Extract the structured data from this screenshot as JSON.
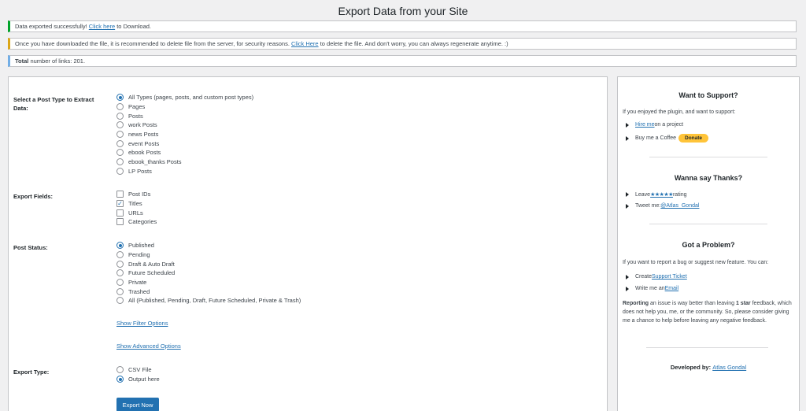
{
  "page_title": "Export Data from your Site",
  "notices": {
    "success": {
      "prefix": "Data exported successfully! ",
      "link": "Click here",
      "suffix": " to Download."
    },
    "warning": {
      "prefix": "Once you have downloaded the file, it is recommended to delete file from the server, for security reasons. ",
      "link": "Click Here",
      "suffix": " to delete the file. And don't worry, you can always regenerate anytime. :)"
    },
    "info": {
      "bold": "Total",
      "text": " number of links: 201."
    }
  },
  "form": {
    "post_type": {
      "label": "Select a Post Type to Extract Data:",
      "options": [
        "All Types (pages, posts, and custom post types)",
        "Pages",
        "Posts",
        "work Posts",
        "news Posts",
        "event Posts",
        "ebook Posts",
        "ebook_thanks Posts",
        "LP Posts"
      ],
      "selected": 0
    },
    "export_fields": {
      "label": "Export Fields:",
      "options": [
        "Post IDs",
        "Titles",
        "URLs",
        "Categories"
      ],
      "checked": [
        1
      ]
    },
    "post_status": {
      "label": "Post Status:",
      "options": [
        "Published",
        "Pending",
        "Draft & Auto Draft",
        "Future Scheduled",
        "Private",
        "Trashed",
        "All (Published, Pending, Draft, Future Scheduled, Private & Trash)"
      ],
      "selected": 0
    },
    "show_filter": "Show Filter Options",
    "show_advanced": "Show Advanced Options",
    "export_type": {
      "label": "Export Type:",
      "options": [
        "CSV File",
        "Output here"
      ],
      "selected": 1
    },
    "export_button": "Export Now"
  },
  "sidebar": {
    "support": {
      "title": "Want to Support?",
      "intro": "If you enjoyed the plugin, and want to support:",
      "hire_link": "Hire me",
      "hire_suffix": " on a project",
      "coffee": "Buy me a Coffee",
      "donate": "Donate"
    },
    "thanks": {
      "title": "Wanna say Thanks?",
      "leave": "Leave ",
      "stars": "★★★★★",
      "rating": " rating",
      "tweet": "Tweet me: ",
      "handle": "@Atlas_Gondal"
    },
    "problem": {
      "title": "Got a Problem?",
      "intro": "If you want to report a bug or suggest new feature. You can:",
      "create": "Create ",
      "ticket": "Support Ticket",
      "write": "Write me an ",
      "email": "Email",
      "para_bold1": "Reporting",
      "para_mid": " an issue is way better than leaving ",
      "para_bold2": "1 star",
      "para_end": " feedback, which does not help you, me, or the community. So, please consider giving me a chance to help before leaving any negative feedback."
    },
    "developer": {
      "prefix": "Developed by: ",
      "name": "Atlas Gondal"
    }
  }
}
